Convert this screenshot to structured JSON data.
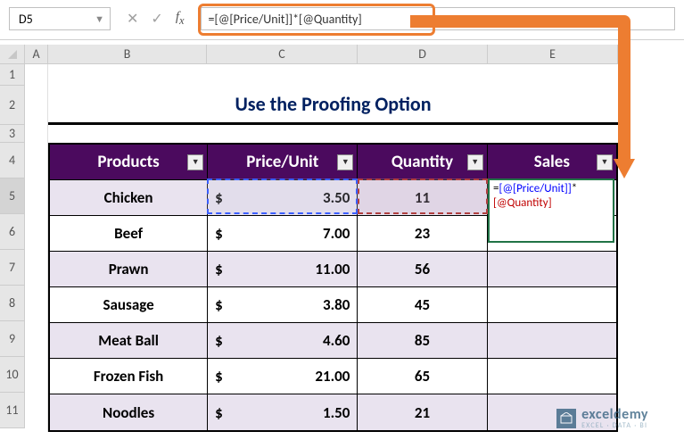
{
  "name_box": "D5",
  "formula_bar": "=[@[Price/Unit]]*[@Quantity]",
  "columns": [
    "A",
    "B",
    "C",
    "D",
    "E"
  ],
  "rows": [
    "1",
    "2",
    "3",
    "4",
    "5",
    "6",
    "7",
    "8",
    "9",
    "10",
    "11"
  ],
  "title": "Use the Proofing Option",
  "table": {
    "headers": {
      "products": "Products",
      "price": "Price/Unit",
      "qty": "Quantity",
      "sales": "Sales"
    },
    "rows": [
      {
        "product": "Chicken",
        "currency": "$",
        "price": "3.50",
        "qty": "11"
      },
      {
        "product": "Beef",
        "currency": "$",
        "price": "7.00",
        "qty": "23"
      },
      {
        "product": "Prawn",
        "currency": "$",
        "price": "11.00",
        "qty": "56"
      },
      {
        "product": "Sausage",
        "currency": "$",
        "price": "3.80",
        "qty": "45"
      },
      {
        "product": "Meat Ball",
        "currency": "$",
        "price": "4.60",
        "qty": "85"
      },
      {
        "product": "Frozen Fish",
        "currency": "$",
        "price": "21.00",
        "qty": "65"
      },
      {
        "product": "Noodles",
        "currency": "$",
        "price": "1.50",
        "qty": "21"
      }
    ]
  },
  "editing": {
    "eq": "=",
    "ref1": "[@[Price/Unit]]",
    "star": "*",
    "ref2": "[@Quantity]"
  },
  "watermark": {
    "name": "exceldemy",
    "tag": "EXCEL · DATA · BI"
  },
  "chart_data": {
    "type": "table",
    "title": "Use the Proofing Option",
    "columns": [
      "Products",
      "Price/Unit",
      "Quantity",
      "Sales"
    ],
    "rows": [
      [
        "Chicken",
        3.5,
        11,
        null
      ],
      [
        "Beef",
        7.0,
        23,
        null
      ],
      [
        "Prawn",
        11.0,
        56,
        null
      ],
      [
        "Sausage",
        3.8,
        45,
        null
      ],
      [
        "Meat Ball",
        4.6,
        85,
        null
      ],
      [
        "Frozen Fish",
        21.0,
        65,
        null
      ],
      [
        "Noodles",
        1.5,
        21,
        null
      ]
    ],
    "formula_cell": {
      "address": "E5",
      "formula": "=[@[Price/Unit]]*[@Quantity]"
    }
  }
}
